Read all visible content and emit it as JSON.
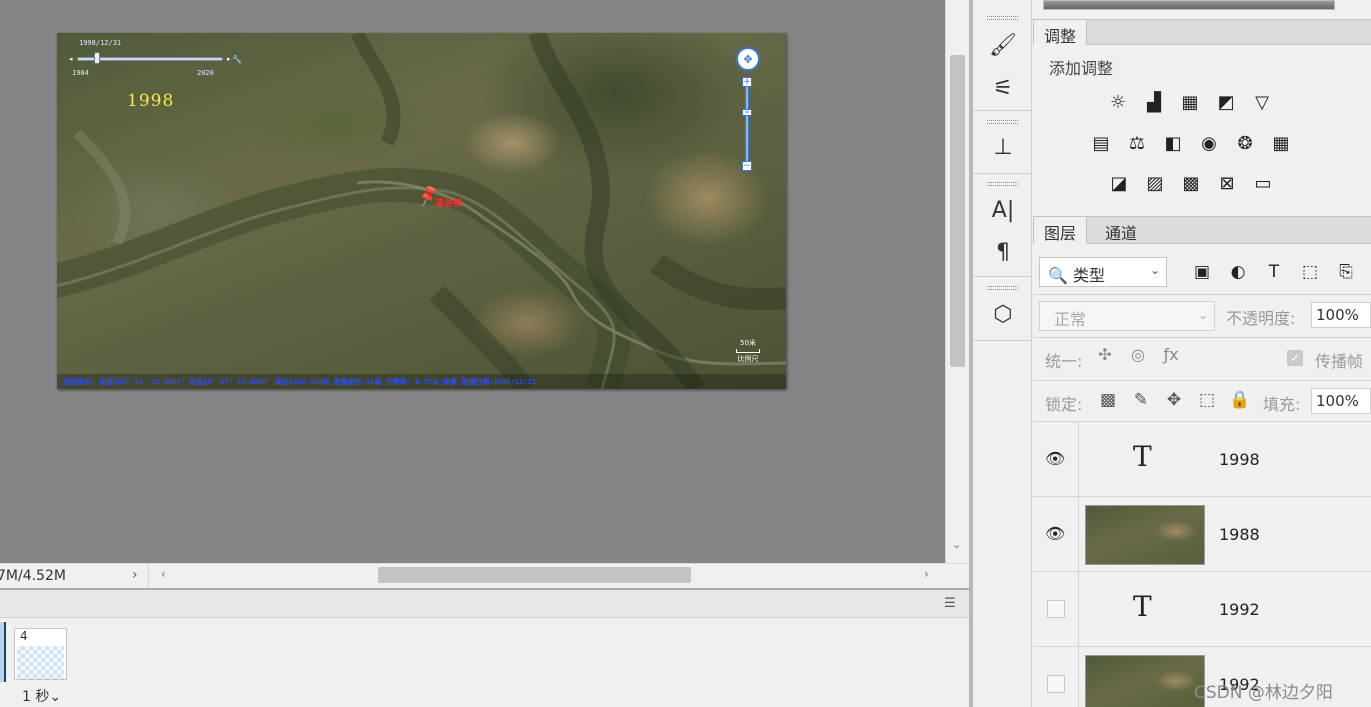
{
  "map": {
    "date_top": "1998/12/31",
    "slider_start_year": "1984",
    "slider_end_year": "2020",
    "slider_fraction": 0.14,
    "year_overlay": "1998",
    "marker_label": "溪谷坡",
    "scale_text": "50米",
    "scale_sub": "比例尺",
    "status_text": "当前坐标: 经度106° 35' 21.0000\" 纬度29° 47' 31.0000\" 高程1452.083米    影像级别:18级  分辨率: 0.57米/像素     拍摄日期:1998/12/31",
    "icons": {
      "compass": "pan-compass-icon",
      "zoom_in": "zoom-plus-icon",
      "zoom_out": "zoom-minus-icon",
      "pin": "pushpin-icon",
      "wrench": "wrench-icon"
    }
  },
  "status_bar": {
    "doc_size": "7M/4.52M",
    "arrow": "›"
  },
  "timeline": {
    "frame_number": "4",
    "frame_delay": "1 秒",
    "delay_caret": "⌄"
  },
  "adjustments": {
    "tab": "调整",
    "title": "添加调整"
  },
  "layers_panel": {
    "tab_layers": "图层",
    "tab_channels": "通道",
    "filter_label": "类型",
    "blend_mode": "正常",
    "opacity_label": "不透明度:",
    "opacity_value": "100%",
    "unify_label": "统一:",
    "propagate_label": "传播帧",
    "lock_label": "锁定:",
    "fill_label": "填充:",
    "fill_value": "100%",
    "layers": [
      {
        "name": "1998",
        "type": "text",
        "visible": true
      },
      {
        "name": "1988",
        "type": "image",
        "visible": true
      },
      {
        "name": "1992",
        "type": "text",
        "visible": false
      },
      {
        "name": "1992",
        "type": "image",
        "visible": false
      }
    ]
  },
  "watermark": "CSDN @林边夕阳",
  "colors": {
    "accent": "#3a78d0",
    "year_overlay": "#f4ea4a",
    "marker": "#ff2b2b",
    "status_text": "#2a4cff"
  }
}
